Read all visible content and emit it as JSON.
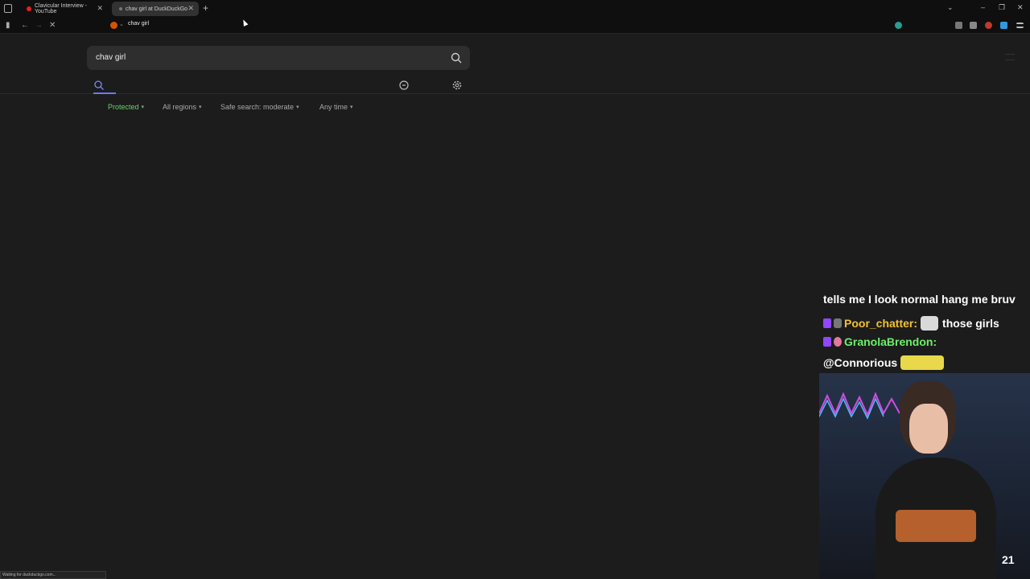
{
  "tabs": [
    {
      "title": "Clavicular Interview - YouTube"
    },
    {
      "title": "chav girl at DuckDuckGo"
    }
  ],
  "address_bar": {
    "url": "chav girl"
  },
  "search": {
    "query": "chav girl"
  },
  "filters": {
    "protected": "Protected",
    "region": "All regions",
    "safe_search": "Safe search: moderate",
    "time": "Any time"
  },
  "stream_chat": {
    "line1": "tells me I look normal hang me bruv",
    "line2_user": "Poor_chatter:",
    "line2_text": "those girls",
    "line3_user": "GranolaBrendon:",
    "line4_text": "@Connorious"
  },
  "webcam": {
    "counter": "21"
  },
  "status_text": "Waiting for duckduckgo.com...",
  "colors": {
    "accent": "#6a79f7",
    "protected": "#6fcf6f",
    "username_yellow": "#f1c232",
    "username_green": "#6cf06c"
  }
}
